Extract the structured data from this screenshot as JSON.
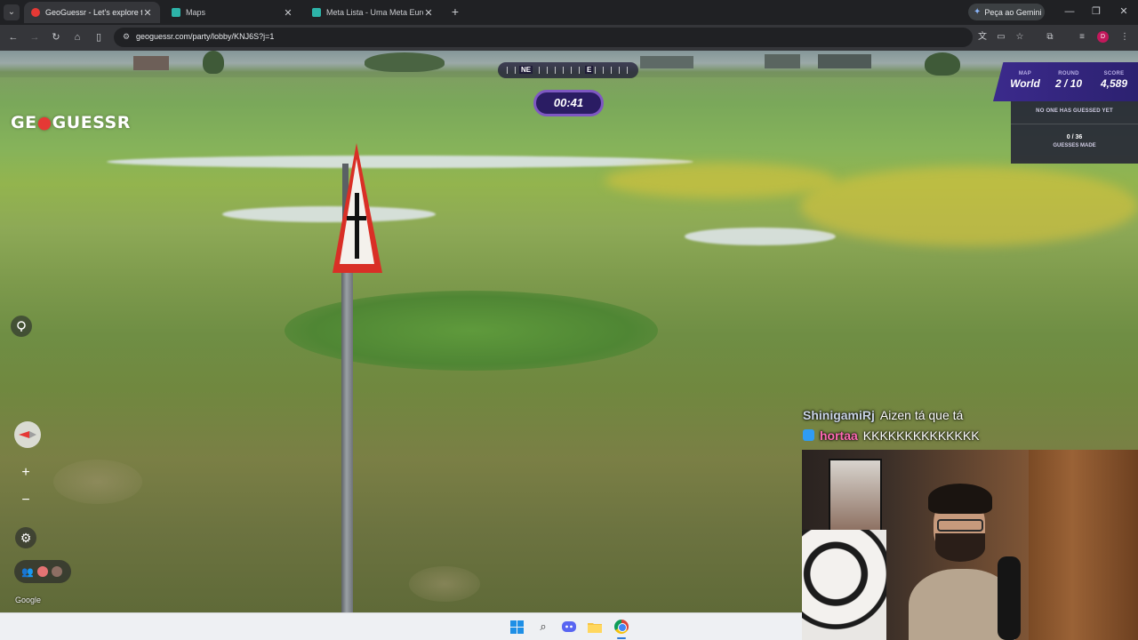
{
  "browser": {
    "tabs": [
      {
        "title": "GeoGuessr - Let's explore the w",
        "active": true,
        "favicon_color": "#e53935"
      },
      {
        "title": "Maps",
        "active": false,
        "favicon_color": "#2db3a8"
      },
      {
        "title": "Meta Lista - Uma Meta Europa",
        "active": false,
        "favicon_color": "#2db3a8"
      }
    ],
    "new_tab_icon": "+",
    "gemini_label": "Peça ao Gemini",
    "url": "geoguessr.com/party/lobby/KNJ6S?j=1",
    "profile_initial": "D"
  },
  "game": {
    "logo_left": "GE",
    "logo_right": "GUESSR",
    "compass": {
      "ne": "NE",
      "e": "E"
    },
    "timer": "00:41",
    "map_label": "MAP",
    "map_value": "World",
    "round_label": "ROUND",
    "round_value": "2 / 10",
    "score_label": "SCORE",
    "score_value": "4,589",
    "no_guess_text": "NO ONE HAS GUESSED YET",
    "guess_count": "0 / 36",
    "guesses_made_label": "GUESSES MADE",
    "zoom_in": "+",
    "zoom_out": "−",
    "attribution": "Google"
  },
  "chat": [
    {
      "user": "ShinigamiRj",
      "message": "Aizen tá que tá"
    },
    {
      "user": "hortaa",
      "message": "KKKKKKKKKKKKKK"
    }
  ],
  "colors": {
    "accent_purple": "#7e57c2",
    "panel_purple": "#2c2170",
    "logo_red": "#e53935"
  },
  "icons": [
    "tab-search-icon",
    "back-icon",
    "forward-icon",
    "reload-icon",
    "home-icon",
    "sidebar-icon",
    "site-info-icon",
    "translate-icon",
    "cast-icon",
    "bookmark-star-icon",
    "extensions-icon",
    "media-icon",
    "menu-icon",
    "pin-toggle-icon",
    "compass-icon",
    "settings-gear-icon",
    "players-icon",
    "windows-start-icon",
    "search-icon",
    "discord-icon",
    "file-explorer-icon",
    "chrome-icon"
  ]
}
